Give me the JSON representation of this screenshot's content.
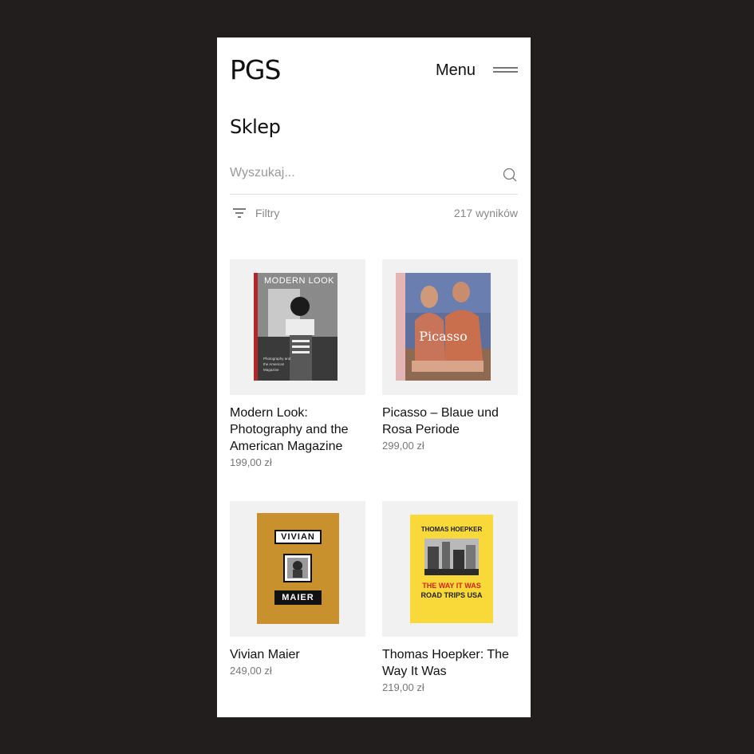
{
  "header": {
    "logo": "PGS",
    "menu_label": "Menu"
  },
  "page": {
    "title": "Sklep"
  },
  "search": {
    "placeholder": "Wyszukaj..."
  },
  "filters": {
    "label": "Filtry",
    "results_count": "217 wyników"
  },
  "products": [
    {
      "name": "Modern Look: Photography and the American Magazine",
      "price": "199,00 zł",
      "cover_text": "MODERN LOOK",
      "cover_subtitle": "Photography and the American Magazine"
    },
    {
      "name": "Picasso – Blaue und Rosa Periode",
      "price": "299,00 zł",
      "cover_text": "Picasso"
    },
    {
      "name": "Vivian Maier",
      "price": "249,00 zł",
      "cover_text_top": "VIVIAN",
      "cover_text_bottom": "MAIER"
    },
    {
      "name": "Thomas Hoepker: The Way It Was",
      "price": "219,00 zł",
      "cover_author": "THOMAS HOEPKER",
      "cover_title_1": "THE WAY IT WAS",
      "cover_title_2": "ROAD TRIPS USA"
    }
  ],
  "icons": {
    "menu": "hamburger-icon",
    "search": "search-icon",
    "filter": "filter-icon"
  },
  "colors": {
    "background": "#221e1e",
    "surface": "#ffffff",
    "thumb_bg": "#f1f1f1",
    "text": "#111111",
    "muted": "#888888"
  }
}
